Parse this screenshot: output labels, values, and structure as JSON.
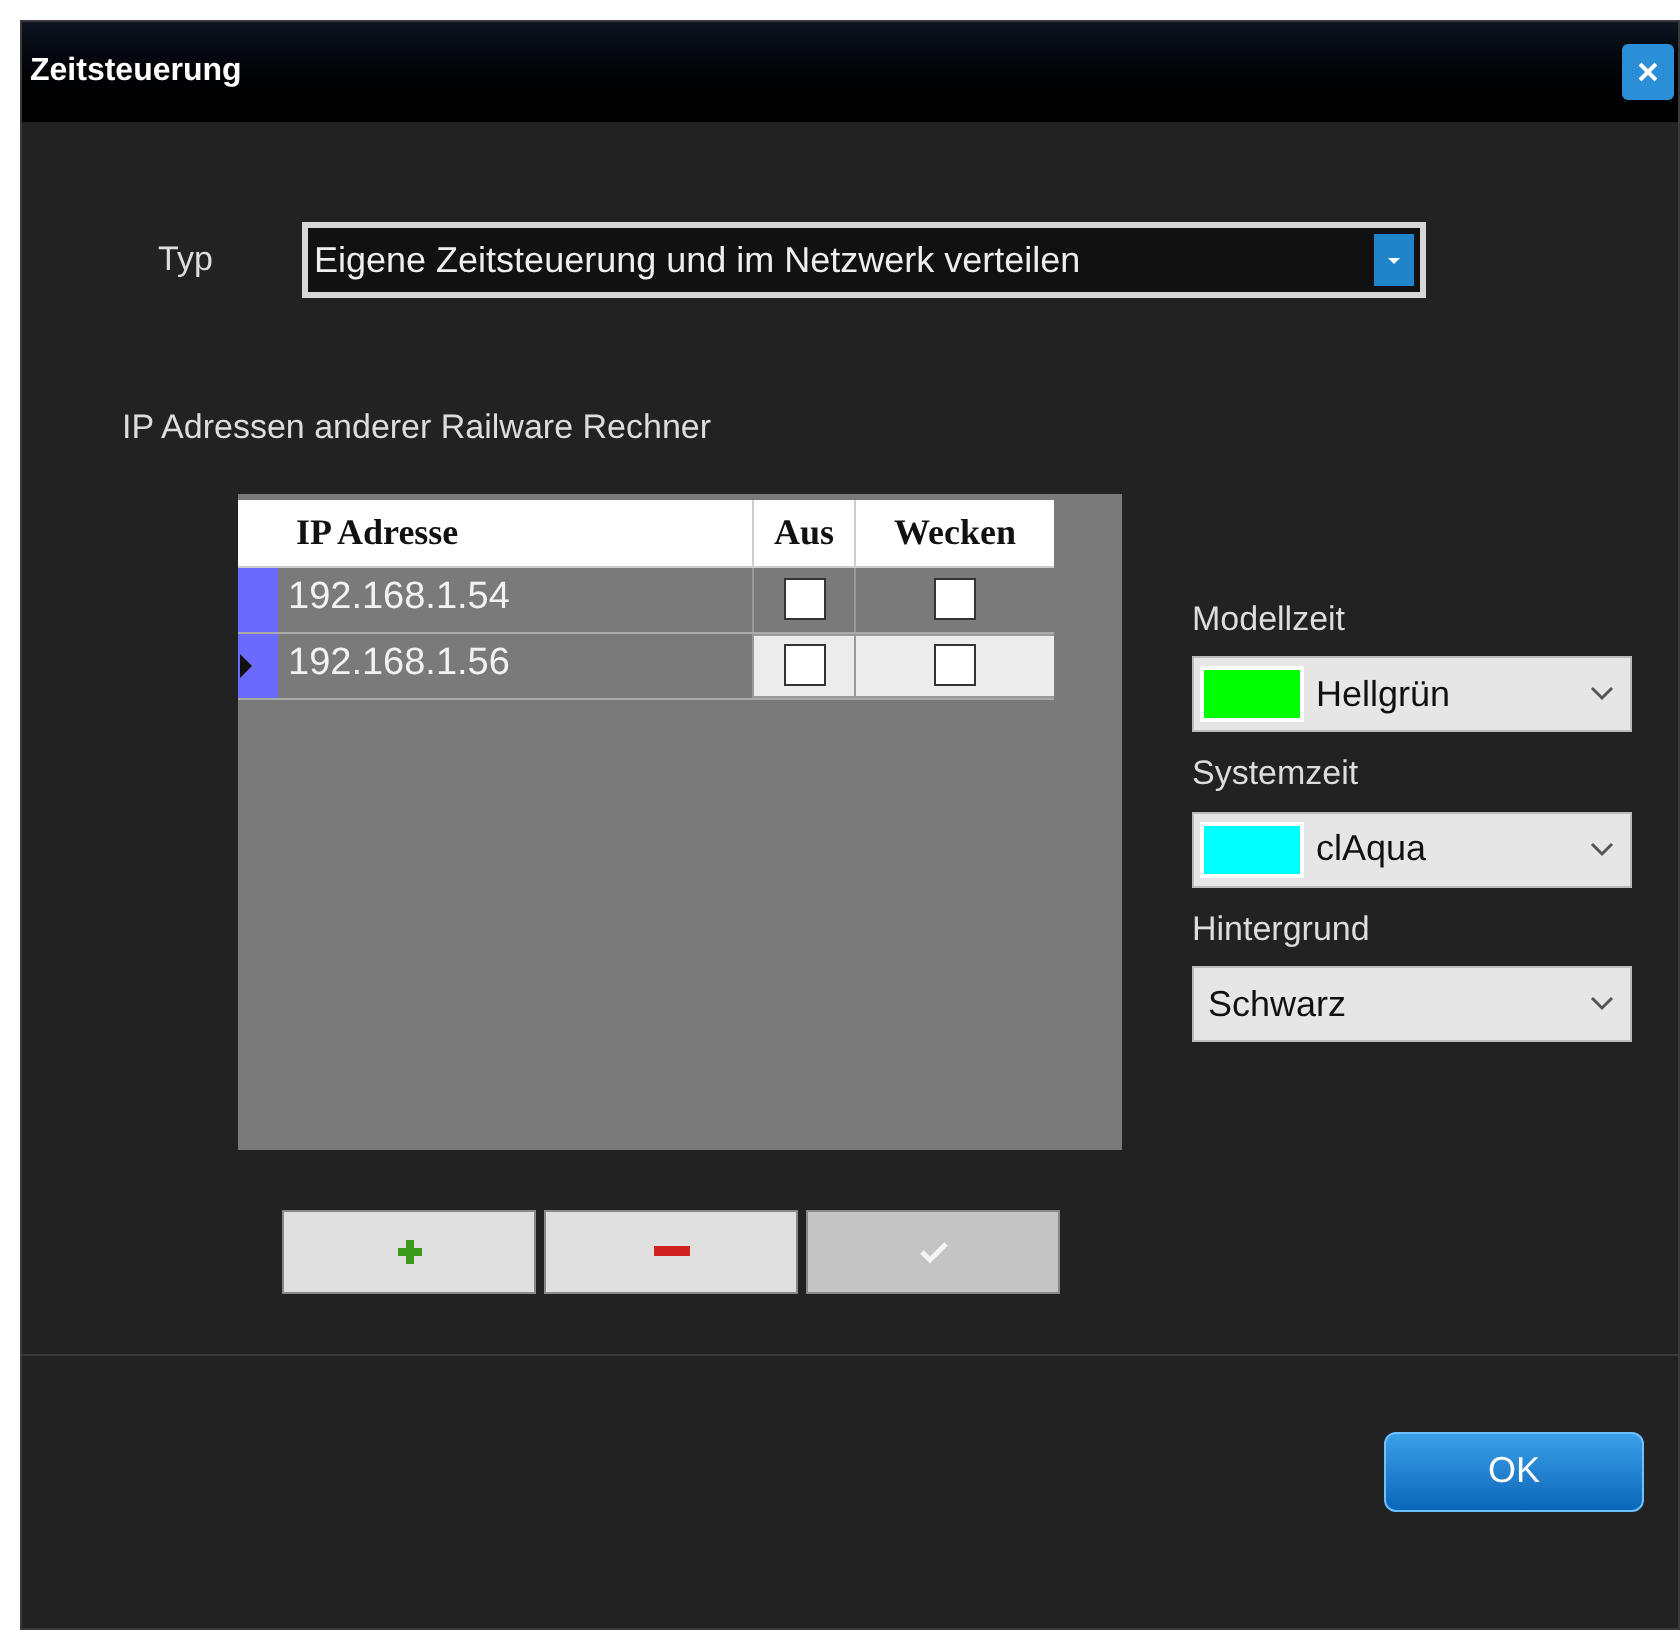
{
  "window": {
    "title": "Zeitsteuerung"
  },
  "typ": {
    "label": "Typ",
    "value": "Eigene Zeitsteuerung und im Netzwerk verteilen"
  },
  "ip_section": {
    "label": "IP Adressen anderer Railware Rechner"
  },
  "table": {
    "columns": [
      "IP Adresse",
      "Aus",
      "Wecken"
    ],
    "rows": [
      {
        "ip": "192.168.1.54",
        "aus": false,
        "wecken": false,
        "selected": false
      },
      {
        "ip": "192.168.1.56",
        "aus": false,
        "wecken": false,
        "selected": true
      }
    ]
  },
  "buttons": [
    {
      "kind": "add",
      "disabled": false
    },
    {
      "kind": "remove",
      "disabled": false
    },
    {
      "kind": "confirm",
      "disabled": true
    }
  ],
  "colors": [
    {
      "label": "Modellzeit",
      "value": "Hellgrün",
      "color": "#00ff00"
    },
    {
      "label": "Systemzeit",
      "value": "clAqua",
      "color": "#00ffff"
    },
    {
      "label": "Hintergrund",
      "value": "Schwarz"
    }
  ],
  "ok_button": "OK"
}
